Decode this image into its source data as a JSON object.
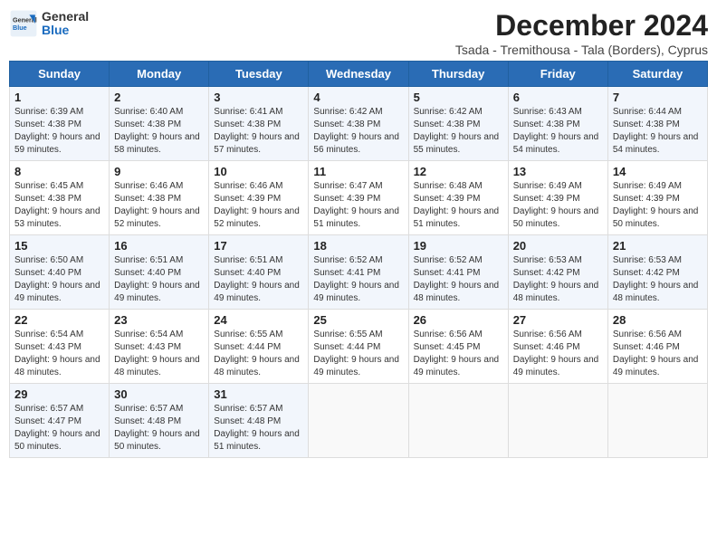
{
  "logo": {
    "general": "General",
    "blue": "Blue"
  },
  "title": "December 2024",
  "subtitle": "Tsada - Tremithousa - Tala (Borders), Cyprus",
  "days_header": [
    "Sunday",
    "Monday",
    "Tuesday",
    "Wednesday",
    "Thursday",
    "Friday",
    "Saturday"
  ],
  "weeks": [
    [
      {
        "day": "1",
        "sunrise": "Sunrise: 6:39 AM",
        "sunset": "Sunset: 4:38 PM",
        "daylight": "Daylight: 9 hours and 59 minutes."
      },
      {
        "day": "2",
        "sunrise": "Sunrise: 6:40 AM",
        "sunset": "Sunset: 4:38 PM",
        "daylight": "Daylight: 9 hours and 58 minutes."
      },
      {
        "day": "3",
        "sunrise": "Sunrise: 6:41 AM",
        "sunset": "Sunset: 4:38 PM",
        "daylight": "Daylight: 9 hours and 57 minutes."
      },
      {
        "day": "4",
        "sunrise": "Sunrise: 6:42 AM",
        "sunset": "Sunset: 4:38 PM",
        "daylight": "Daylight: 9 hours and 56 minutes."
      },
      {
        "day": "5",
        "sunrise": "Sunrise: 6:42 AM",
        "sunset": "Sunset: 4:38 PM",
        "daylight": "Daylight: 9 hours and 55 minutes."
      },
      {
        "day": "6",
        "sunrise": "Sunrise: 6:43 AM",
        "sunset": "Sunset: 4:38 PM",
        "daylight": "Daylight: 9 hours and 54 minutes."
      },
      {
        "day": "7",
        "sunrise": "Sunrise: 6:44 AM",
        "sunset": "Sunset: 4:38 PM",
        "daylight": "Daylight: 9 hours and 54 minutes."
      }
    ],
    [
      {
        "day": "8",
        "sunrise": "Sunrise: 6:45 AM",
        "sunset": "Sunset: 4:38 PM",
        "daylight": "Daylight: 9 hours and 53 minutes."
      },
      {
        "day": "9",
        "sunrise": "Sunrise: 6:46 AM",
        "sunset": "Sunset: 4:38 PM",
        "daylight": "Daylight: 9 hours and 52 minutes."
      },
      {
        "day": "10",
        "sunrise": "Sunrise: 6:46 AM",
        "sunset": "Sunset: 4:39 PM",
        "daylight": "Daylight: 9 hours and 52 minutes."
      },
      {
        "day": "11",
        "sunrise": "Sunrise: 6:47 AM",
        "sunset": "Sunset: 4:39 PM",
        "daylight": "Daylight: 9 hours and 51 minutes."
      },
      {
        "day": "12",
        "sunrise": "Sunrise: 6:48 AM",
        "sunset": "Sunset: 4:39 PM",
        "daylight": "Daylight: 9 hours and 51 minutes."
      },
      {
        "day": "13",
        "sunrise": "Sunrise: 6:49 AM",
        "sunset": "Sunset: 4:39 PM",
        "daylight": "Daylight: 9 hours and 50 minutes."
      },
      {
        "day": "14",
        "sunrise": "Sunrise: 6:49 AM",
        "sunset": "Sunset: 4:39 PM",
        "daylight": "Daylight: 9 hours and 50 minutes."
      }
    ],
    [
      {
        "day": "15",
        "sunrise": "Sunrise: 6:50 AM",
        "sunset": "Sunset: 4:40 PM",
        "daylight": "Daylight: 9 hours and 49 minutes."
      },
      {
        "day": "16",
        "sunrise": "Sunrise: 6:51 AM",
        "sunset": "Sunset: 4:40 PM",
        "daylight": "Daylight: 9 hours and 49 minutes."
      },
      {
        "day": "17",
        "sunrise": "Sunrise: 6:51 AM",
        "sunset": "Sunset: 4:40 PM",
        "daylight": "Daylight: 9 hours and 49 minutes."
      },
      {
        "day": "18",
        "sunrise": "Sunrise: 6:52 AM",
        "sunset": "Sunset: 4:41 PM",
        "daylight": "Daylight: 9 hours and 49 minutes."
      },
      {
        "day": "19",
        "sunrise": "Sunrise: 6:52 AM",
        "sunset": "Sunset: 4:41 PM",
        "daylight": "Daylight: 9 hours and 48 minutes."
      },
      {
        "day": "20",
        "sunrise": "Sunrise: 6:53 AM",
        "sunset": "Sunset: 4:42 PM",
        "daylight": "Daylight: 9 hours and 48 minutes."
      },
      {
        "day": "21",
        "sunrise": "Sunrise: 6:53 AM",
        "sunset": "Sunset: 4:42 PM",
        "daylight": "Daylight: 9 hours and 48 minutes."
      }
    ],
    [
      {
        "day": "22",
        "sunrise": "Sunrise: 6:54 AM",
        "sunset": "Sunset: 4:43 PM",
        "daylight": "Daylight: 9 hours and 48 minutes."
      },
      {
        "day": "23",
        "sunrise": "Sunrise: 6:54 AM",
        "sunset": "Sunset: 4:43 PM",
        "daylight": "Daylight: 9 hours and 48 minutes."
      },
      {
        "day": "24",
        "sunrise": "Sunrise: 6:55 AM",
        "sunset": "Sunset: 4:44 PM",
        "daylight": "Daylight: 9 hours and 48 minutes."
      },
      {
        "day": "25",
        "sunrise": "Sunrise: 6:55 AM",
        "sunset": "Sunset: 4:44 PM",
        "daylight": "Daylight: 9 hours and 49 minutes."
      },
      {
        "day": "26",
        "sunrise": "Sunrise: 6:56 AM",
        "sunset": "Sunset: 4:45 PM",
        "daylight": "Daylight: 9 hours and 49 minutes."
      },
      {
        "day": "27",
        "sunrise": "Sunrise: 6:56 AM",
        "sunset": "Sunset: 4:46 PM",
        "daylight": "Daylight: 9 hours and 49 minutes."
      },
      {
        "day": "28",
        "sunrise": "Sunrise: 6:56 AM",
        "sunset": "Sunset: 4:46 PM",
        "daylight": "Daylight: 9 hours and 49 minutes."
      }
    ],
    [
      {
        "day": "29",
        "sunrise": "Sunrise: 6:57 AM",
        "sunset": "Sunset: 4:47 PM",
        "daylight": "Daylight: 9 hours and 50 minutes."
      },
      {
        "day": "30",
        "sunrise": "Sunrise: 6:57 AM",
        "sunset": "Sunset: 4:48 PM",
        "daylight": "Daylight: 9 hours and 50 minutes."
      },
      {
        "day": "31",
        "sunrise": "Sunrise: 6:57 AM",
        "sunset": "Sunset: 4:48 PM",
        "daylight": "Daylight: 9 hours and 51 minutes."
      },
      null,
      null,
      null,
      null
    ]
  ]
}
